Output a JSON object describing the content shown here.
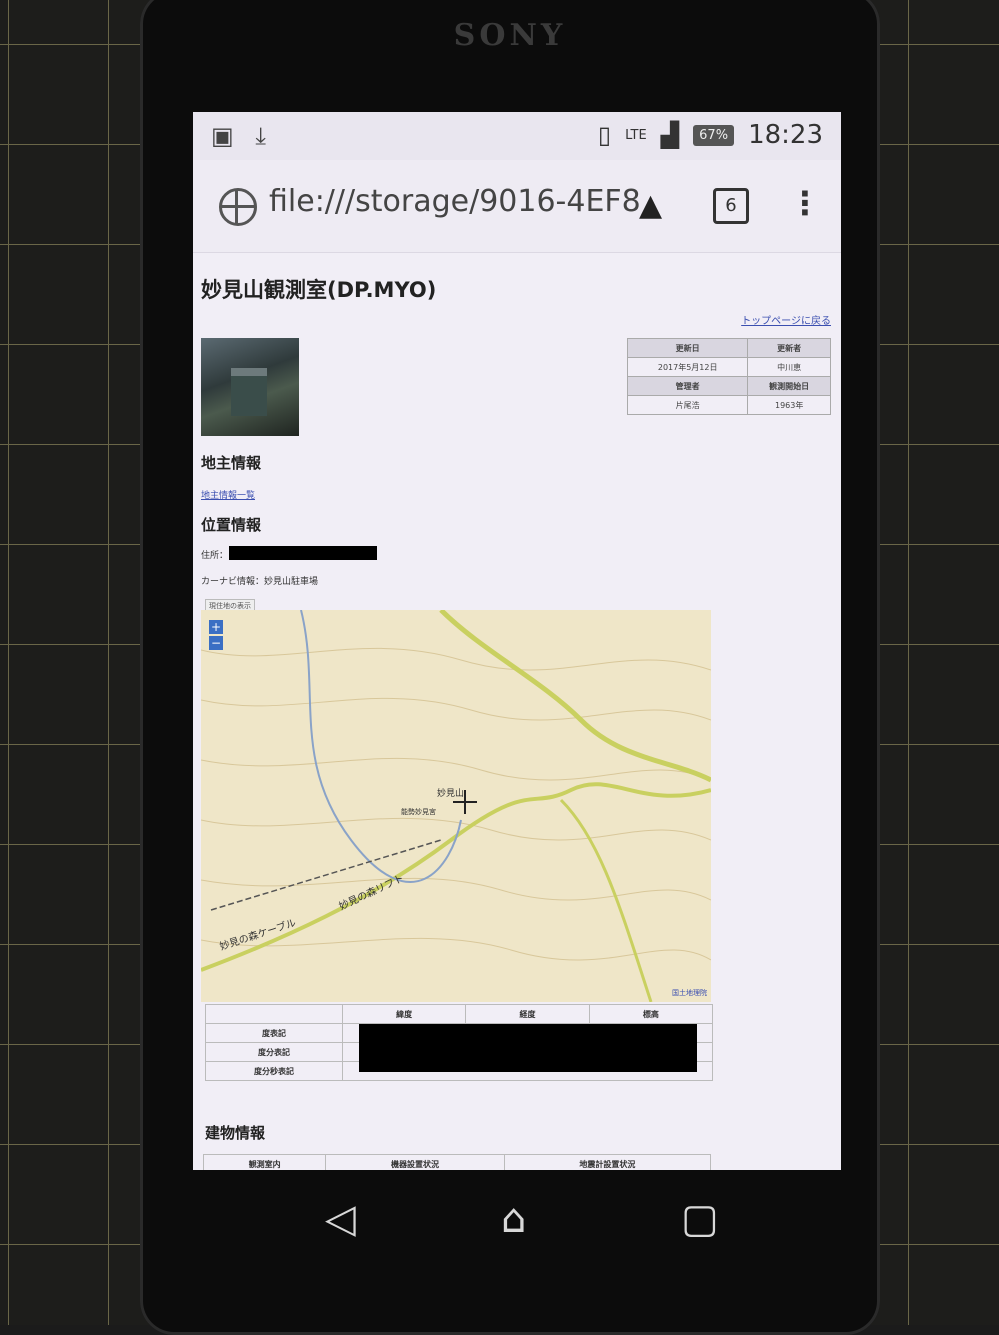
{
  "device": {
    "brand": "SONY"
  },
  "status_bar": {
    "battery": "67%",
    "network": "LTE",
    "time": "18:23"
  },
  "browser": {
    "url": "file:///storage/9016-4EF8/t",
    "tab_count": "6",
    "menu_glyph": "⋮",
    "android_glyph": "▲"
  },
  "page": {
    "title": "妙見山観測室(DP.MYO)",
    "top_link": "トップページに戻る",
    "info_table": {
      "headers_row1": [
        "更新日",
        "更新者"
      ],
      "values_row1": [
        "2017年5月12日",
        "中川恵"
      ],
      "headers_row2": [
        "管理者",
        "観測開始日"
      ],
      "values_row2": [
        "片尾浩",
        "1963年"
      ]
    },
    "landowner_heading": "地主情報",
    "landowner_link": "地主情報一覧",
    "location_heading": "位置情報",
    "address_label": "住所：",
    "carnavi": "カーナビ情報：妙見山駐車場",
    "map_toggle": "現住地の表示",
    "map_attribution": "国土地理院",
    "map_labels": {
      "peak": "妙見山",
      "shrine": "能勢妙見宮",
      "cable": "妙見の森ケーブル",
      "lift": "妙見の森リフト"
    },
    "coords_table": {
      "headers": [
        "緯度",
        "経度",
        "標高"
      ],
      "rows": [
        "度表記",
        "度分表記",
        "度分秒表記"
      ]
    },
    "building_heading": "建物情報",
    "building_table": {
      "headers": [
        "観測室内",
        "機器設置状況",
        "地震計設置状況"
      ]
    }
  }
}
